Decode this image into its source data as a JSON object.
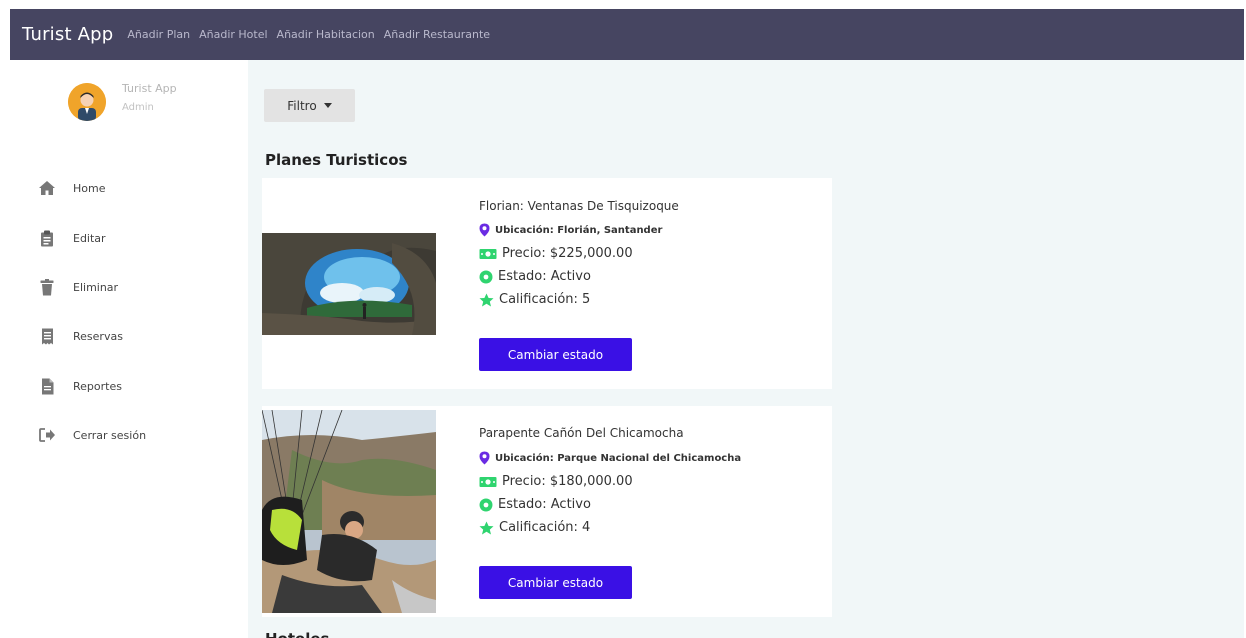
{
  "topbar": {
    "brand": "Turist App",
    "nav": [
      "Añadir Plan",
      "Añadir Hotel",
      "Añadir Habitacion",
      "Añadir Restaurante"
    ]
  },
  "profile": {
    "name": "Turist App",
    "role": "Admin"
  },
  "sidebar": {
    "items": [
      {
        "label": "Home",
        "icon": "home-icon"
      },
      {
        "label": "Editar",
        "icon": "clipboard-icon"
      },
      {
        "label": "Eliminar",
        "icon": "trash-icon"
      },
      {
        "label": "Reservas",
        "icon": "receipt-icon"
      },
      {
        "label": "Reportes",
        "icon": "file-icon"
      },
      {
        "label": "Cerrar sesión",
        "icon": "sign-out-icon"
      }
    ]
  },
  "filter": {
    "label": "Filtro"
  },
  "sections": {
    "plans_title": "Planes Turisticos",
    "next_title": "Hoteles"
  },
  "plans": [
    {
      "title": "Florian: Ventanas De Tisquizoque",
      "location": "Ubicación: Florián, Santander",
      "price": "Precio: $225,000.00",
      "status": "Estado: Activo",
      "rating": "Calificación: 5",
      "button": "Cambiar estado"
    },
    {
      "title": "Parapente Cañón Del Chicamocha",
      "location": "Ubicación: Parque Nacional del Chicamocha",
      "price": "Precio: $180,000.00",
      "status": "Estado: Activo",
      "rating": "Calificación: 4",
      "button": "Cambiar estado"
    }
  ],
  "colors": {
    "topbar": "#464561",
    "accent": "#3a10e5",
    "location_pin": "#6a2be3",
    "money": "#2fd46f",
    "status_dot": "#2fd46f",
    "star": "#2fd46f",
    "main_bg": "#f1f7f8"
  }
}
